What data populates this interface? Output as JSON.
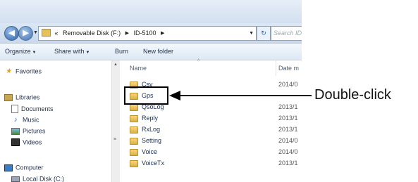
{
  "address": {
    "prefix": "«",
    "path": [
      "Removable Disk (F:)",
      "ID-5100"
    ],
    "search_placeholder": "Search ID-"
  },
  "toolbar": {
    "organize": "Organize",
    "share_with": "Share with",
    "burn": "Burn",
    "new_folder": "New folder"
  },
  "nav": {
    "favorites": "Favorites",
    "libraries": "Libraries",
    "documents": "Documents",
    "music": "Music",
    "pictures": "Pictures",
    "videos": "Videos",
    "computer": "Computer",
    "local_disk": "Local Disk (C:)"
  },
  "columns": {
    "name": "Name",
    "date": "Date m"
  },
  "files": [
    {
      "name": "Csv",
      "date": "2014/0"
    },
    {
      "name": "Gps",
      "date": ""
    },
    {
      "name": "QsoLog",
      "date": "2013/1"
    },
    {
      "name": "Reply",
      "date": "2013/1"
    },
    {
      "name": "RxLog",
      "date": "2013/1"
    },
    {
      "name": "Setting",
      "date": "2014/0"
    },
    {
      "name": "Voice",
      "date": "2014/0"
    },
    {
      "name": "VoiceTx",
      "date": "2013/1"
    }
  ],
  "callout": "Double-click"
}
